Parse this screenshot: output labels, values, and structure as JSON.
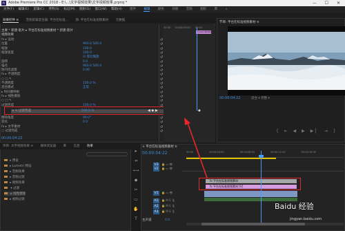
{
  "titlebar": {
    "app_logo": "Pr",
    "title": "Adobe Premiere Pro CC 2018 - E:\\...\\文字视频效果\\文字视频效果.prproj *",
    "controls": "— ☐ ✕"
  },
  "menu": {
    "items": [
      "文件(F)",
      "编辑(E)",
      "剪辑(C)",
      "序列(S)",
      "标记(M)",
      "图形(G)",
      "窗口(W)",
      "帮助(H)"
    ]
  },
  "workspaces": {
    "items": [
      "组件",
      "编辑",
      "颜色",
      "效果",
      "音频",
      "图形",
      "库",
      "»"
    ],
    "active_index": 1
  },
  "effect_controls": {
    "tabs": [
      "效果控件 ≡",
      "音频剪辑混合器: 平台在标准...",
      "源: 平台在标准视频素材",
      "元数据"
    ],
    "header": "主要 * 新建-影片 ▸ 平台在标准视频素材 * 新建-影片",
    "section_video": "视频效果",
    "rows": [
      {
        "label": "fx ▸ 运动",
        "value": ""
      },
      {
        "label": "  位置",
        "value": "960.0  540.0"
      },
      {
        "label": "  缩放",
        "value": "100.0"
      },
      {
        "label": "  缩放宽度",
        "value": "100.0"
      },
      {
        "label": "",
        "value": "☑ 等比缩放"
      },
      {
        "label": "  旋转",
        "value": "0.0"
      },
      {
        "label": "  锚点",
        "value": "960.0  540.0"
      },
      {
        "label": "  防闪烁滤镜",
        "value": "0.00"
      },
      {
        "label": "fx ▸ 不透明度",
        "value": ""
      },
      {
        "label": "  ○ □ ✎",
        "value": ""
      },
      {
        "label": "  不透明度",
        "value": "100.0 %"
      },
      {
        "label": "  混合模式",
        "value": "正常"
      },
      {
        "label": "▸ 时间重映射",
        "value": ""
      },
      {
        "label": "fx ▸ 线性擦除",
        "value": ""
      },
      {
        "label": "  ○ □ ✎",
        "value": ""
      },
      {
        "label": "  过渡完成",
        "value": "100.0 %"
      },
      {
        "label": "  擦除角度",
        "value": "90.0°"
      },
      {
        "label": "  羽化",
        "value": "0.0"
      },
      {
        "label": "fx ▸ 文字素材",
        "value": ""
      },
      {
        "label": "  ○ 过渡完成",
        "value": ""
      }
    ],
    "highlighted_row": {
      "label": "▸ ⊙ 过渡完成",
      "value": "100.0 %"
    },
    "ruler_times": [
      "00:00",
      "00:00:05:00",
      "00:00"
    ],
    "clip_name": "平台在标准视频素材",
    "timecode": "00:00:04:22"
  },
  "program_monitor": {
    "title": "节目: 平台在标准视频素材 ≡",
    "timecode": "00:00:04:22",
    "fit": "适合 ▾  完整 ▾",
    "controls": "{ ⇤ ◀ ▶ ▶▏ ⇥ }"
  },
  "project": {
    "tabs": [
      "项目: 文字视频效果 ≡",
      "媒体浏览器",
      "库",
      "信息",
      "效果"
    ],
    "items": [
      "▸ 预设",
      "▸ Lumetri 预设",
      "▸ 音频效果",
      "▸ 音频过渡",
      "▸ 视频效果",
      "  ▾ 过渡",
      "  ▸ 线性擦除",
      "▸ 视频过渡"
    ]
  },
  "tools": [
    "▸",
    "⇸",
    "⟷",
    "◆",
    "✂",
    "▭",
    "✋",
    "T"
  ],
  "timeline": {
    "tab": "× 平台在标准视频素材 ≡",
    "timecode": "00:00:04:22",
    "ruler": [
      "00:00",
      "00:00:04:00",
      "00:00:08:00",
      "00:00:12:00",
      "00:00:16:00"
    ],
    "tracks": [
      "V3",
      "V2",
      "V1",
      "A1",
      "A2",
      "A3",
      "主声道"
    ],
    "clips": [
      {
        "name": "fx 平台在标准视频素材"
      },
      {
        "name": "fx 平台在标准视频素材 [V]"
      }
    ],
    "master_value": "0.0"
  },
  "watermark": {
    "text": "Baidu 经验",
    "sub": "jingyan.baidu.com"
  },
  "colors": {
    "accent": "#4a9bff",
    "highlight": "#e8272a",
    "clip_pink": "#d59dde",
    "clip_gray": "#a7a7a7",
    "clip_blue": "#7f97c5"
  }
}
